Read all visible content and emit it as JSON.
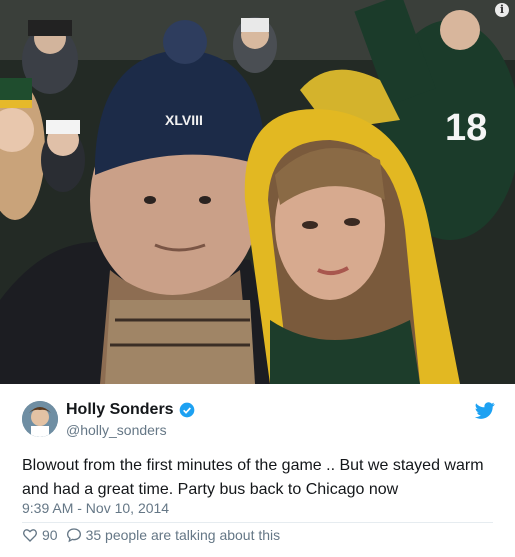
{
  "photo": {
    "alt_icon": "info-icon",
    "hat_text": "XLVIII",
    "jersey_number": "18"
  },
  "tweet": {
    "display_name": "Holly Sonders",
    "handle": "@holly_sonders",
    "text": "Blowout from the first minutes of the game .. But we stayed warm and had a great time. Party bus back to Chicago now",
    "timestamp": "9:39 AM - Nov 10, 2014",
    "like_count": "90",
    "talking_label": "35 people are talking about this",
    "verified_color": "#1da1f2",
    "brand_color": "#1da1f2"
  }
}
